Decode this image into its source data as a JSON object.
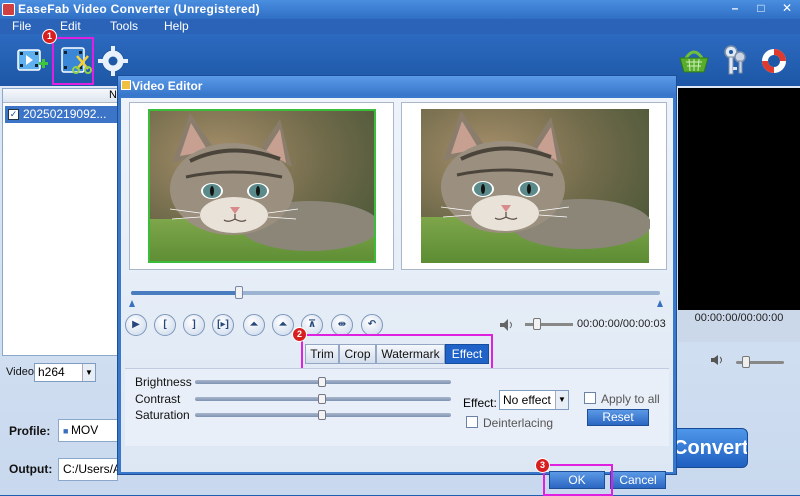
{
  "app": {
    "title": "EaseFab Video Converter (Unregistered)",
    "window_controls": [
      "–",
      "□",
      "✕"
    ],
    "menu": [
      "File",
      "Edit",
      "Tools",
      "Help"
    ]
  },
  "toolbar": {
    "add_video_icon": "add-video-icon",
    "edit_icon": "edit-video-icon",
    "settings_icon": "gear-icon",
    "right_icons": [
      "shopping-basket-icon",
      "keys-icon",
      "lifebuoy-icon"
    ]
  },
  "annotations": {
    "badge1": "1",
    "badge2": "2",
    "badge3": "3",
    "highlight_color": "#e020e0"
  },
  "file_list": {
    "header": "N",
    "items": [
      {
        "name": "20250219092...",
        "checked": true
      }
    ]
  },
  "preview": {
    "time": "00:00:00/00:00:00"
  },
  "video": {
    "label": "Video:",
    "codec": "h264"
  },
  "profile": {
    "label": "Profile:",
    "value": "MOV"
  },
  "output": {
    "label": "Output:",
    "value": "C:/Users/A"
  },
  "convert": {
    "label": "Convert"
  },
  "dialog": {
    "title": "Video Editor",
    "controls": [
      "▶",
      "[",
      "]",
      "[▸]",
      "⏶",
      "⏶",
      "⊼",
      "⇹",
      "↶"
    ],
    "time": "00:00:00/00:00:03",
    "tabs": [
      {
        "label": "Trim",
        "active": false
      },
      {
        "label": "Crop",
        "active": false
      },
      {
        "label": "Watermark",
        "active": false
      },
      {
        "label": "Effect",
        "active": true
      }
    ],
    "sliders": [
      {
        "label": "Brightness",
        "value": 0.5
      },
      {
        "label": "Contrast",
        "value": 0.5
      },
      {
        "label": "Saturation",
        "value": 0.5
      }
    ],
    "effect_label": "Effect:",
    "effect_value": "No effect",
    "apply_to_all": "Apply to all",
    "apply_to_all_checked": false,
    "deinterlacing": "Deinterlacing",
    "deinterlacing_checked": false,
    "reset": "Reset",
    "ok": "OK",
    "cancel": "Cancel",
    "seek_progress": 0.2
  }
}
